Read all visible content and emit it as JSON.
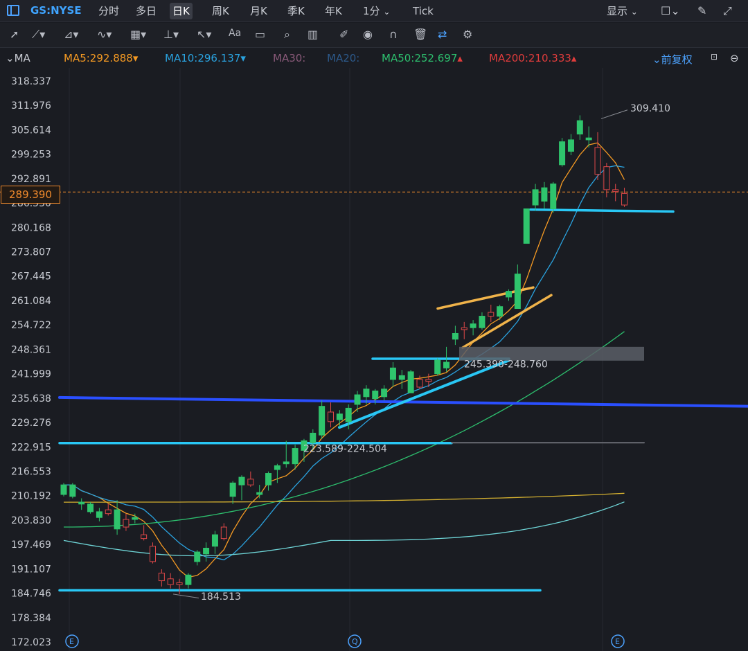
{
  "header": {
    "symbol": "GS:NYSE",
    "tabs": [
      "分时",
      "多日",
      "日K",
      "周K",
      "月K",
      "季K",
      "年K",
      "1分",
      "Tick"
    ],
    "active_tab": "日K",
    "display_label": "显示"
  },
  "toolbar": {
    "tools": [
      "cursor-icon",
      "line-tool-icon",
      "polyline-tool-icon",
      "wave-tool-icon",
      "fibonacci-tool-icon",
      "level-tool-icon",
      "arrow-tool-icon",
      "text-tool-icon",
      "comment-tool-icon",
      "search-icon",
      "indicator-icon",
      "pen-icon",
      "eye-icon",
      "magnet-icon",
      "trash-icon",
      "sync-icon",
      "gear-icon"
    ],
    "text_tool_label": "Aa"
  },
  "ma_bar": {
    "label": "MA",
    "ma5": "MA5:292.888",
    "ma10": "MA10:296.137",
    "ma30": "MA30:",
    "ma20": "MA20:",
    "ma50": "MA50:252.697",
    "ma200": "MA200:210.333",
    "adjust": "前复权",
    "colors": {
      "ma5": "#f59a23",
      "ma10": "#2aa3e0",
      "ma30": "#8a5a7a",
      "ma20": "#2d5a8c",
      "ma50": "#2dbf6e",
      "ma200": "#e03c3c"
    }
  },
  "current_price": "289.390",
  "chart_data": {
    "type": "candlestick",
    "y_ticks": [
      "318.337",
      "311.976",
      "305.614",
      "299.253",
      "292.891",
      "286.530",
      "280.168",
      "273.807",
      "267.445",
      "261.084",
      "254.722",
      "248.361",
      "241.999",
      "235.638",
      "229.276",
      "222.915",
      "216.553",
      "210.192",
      "203.830",
      "197.469",
      "191.107",
      "184.746",
      "178.384",
      "172.023"
    ],
    "ylim": [
      172.023,
      318.337
    ],
    "annotations": {
      "high": "309.410",
      "low": "184.513",
      "zone_upper": "245.390-248.760",
      "zone_lower": "223.589-224.504"
    },
    "event_markers": [
      "E",
      "Q",
      "E"
    ],
    "candles": [
      {
        "o": 210.5,
        "h": 213.5,
        "l": 210.0,
        "c": 213.0
      },
      {
        "o": 210.0,
        "h": 213.5,
        "l": 209.5,
        "c": 213.0
      },
      {
        "o": 208.0,
        "h": 209.5,
        "l": 206.5,
        "c": 208.5
      },
      {
        "o": 206.0,
        "h": 208.5,
        "l": 205.5,
        "c": 208.0
      },
      {
        "o": 204.5,
        "h": 207.0,
        "l": 203.5,
        "c": 206.0
      },
      {
        "o": 206.5,
        "h": 208.0,
        "l": 205.0,
        "c": 205.5
      },
      {
        "o": 201.5,
        "h": 209.0,
        "l": 200.0,
        "c": 206.5
      },
      {
        "o": 204.0,
        "h": 205.5,
        "l": 201.0,
        "c": 202.0
      },
      {
        "o": 204.0,
        "h": 205.5,
        "l": 203.0,
        "c": 204.5
      },
      {
        "o": 200.0,
        "h": 202.5,
        "l": 198.5,
        "c": 199.0
      },
      {
        "o": 197.0,
        "h": 198.0,
        "l": 192.5,
        "c": 193.0
      },
      {
        "o": 190.0,
        "h": 191.0,
        "l": 186.5,
        "c": 188.0
      },
      {
        "o": 188.5,
        "h": 190.0,
        "l": 186.0,
        "c": 187.0
      },
      {
        "o": 187.5,
        "h": 188.5,
        "l": 184.5,
        "c": 187.0
      },
      {
        "o": 187.0,
        "h": 190.0,
        "l": 186.0,
        "c": 189.5
      },
      {
        "o": 193.0,
        "h": 196.0,
        "l": 192.0,
        "c": 195.5
      },
      {
        "o": 195.0,
        "h": 198.0,
        "l": 193.0,
        "c": 196.5
      },
      {
        "o": 197.0,
        "h": 201.0,
        "l": 195.0,
        "c": 200.0
      },
      {
        "o": 202.0,
        "h": 203.0,
        "l": 198.5,
        "c": 199.0
      },
      {
        "o": 210.0,
        "h": 214.0,
        "l": 208.0,
        "c": 213.5
      },
      {
        "o": 213.0,
        "h": 215.5,
        "l": 209.0,
        "c": 215.0
      },
      {
        "o": 214.5,
        "h": 216.5,
        "l": 212.5,
        "c": 213.0
      },
      {
        "o": 210.5,
        "h": 213.0,
        "l": 209.5,
        "c": 211.0
      },
      {
        "o": 213.0,
        "h": 216.5,
        "l": 211.5,
        "c": 216.0
      },
      {
        "o": 217.0,
        "h": 218.5,
        "l": 213.5,
        "c": 218.0
      },
      {
        "o": 218.5,
        "h": 224.5,
        "l": 217.5,
        "c": 219.0
      },
      {
        "o": 218.5,
        "h": 223.5,
        "l": 217.0,
        "c": 222.5
      },
      {
        "o": 222.0,
        "h": 225.0,
        "l": 219.0,
        "c": 224.5
      },
      {
        "o": 224.0,
        "h": 227.5,
        "l": 222.0,
        "c": 226.5
      },
      {
        "o": 226.0,
        "h": 235.0,
        "l": 225.0,
        "c": 233.5
      },
      {
        "o": 232.0,
        "h": 234.5,
        "l": 228.0,
        "c": 229.5
      },
      {
        "o": 230.0,
        "h": 232.5,
        "l": 228.0,
        "c": 231.5
      },
      {
        "o": 229.5,
        "h": 234.0,
        "l": 227.5,
        "c": 233.0
      },
      {
        "o": 234.0,
        "h": 237.5,
        "l": 232.0,
        "c": 236.5
      },
      {
        "o": 236.0,
        "h": 239.0,
        "l": 234.0,
        "c": 238.0
      },
      {
        "o": 235.5,
        "h": 238.0,
        "l": 234.0,
        "c": 237.5
      },
      {
        "o": 236.0,
        "h": 239.0,
        "l": 235.0,
        "c": 238.0
      },
      {
        "o": 240.5,
        "h": 245.0,
        "l": 238.5,
        "c": 243.5
      },
      {
        "o": 240.5,
        "h": 243.0,
        "l": 238.0,
        "c": 241.5
      },
      {
        "o": 237.0,
        "h": 243.0,
        "l": 237.0,
        "c": 242.5
      },
      {
        "o": 240.5,
        "h": 241.5,
        "l": 238.0,
        "c": 238.5
      },
      {
        "o": 240.5,
        "h": 242.0,
        "l": 238.5,
        "c": 240.0
      },
      {
        "o": 242.0,
        "h": 246.0,
        "l": 241.5,
        "c": 245.5
      },
      {
        "o": 243.5,
        "h": 249.0,
        "l": 242.5,
        "c": 245.0
      },
      {
        "o": 251.0,
        "h": 254.5,
        "l": 249.5,
        "c": 252.5
      },
      {
        "o": 254.0,
        "h": 255.5,
        "l": 251.0,
        "c": 253.5
      },
      {
        "o": 254.0,
        "h": 256.0,
        "l": 252.0,
        "c": 255.0
      },
      {
        "o": 254.0,
        "h": 258.0,
        "l": 253.5,
        "c": 257.0
      },
      {
        "o": 258.0,
        "h": 260.0,
        "l": 255.5,
        "c": 257.0
      },
      {
        "o": 257.0,
        "h": 260.0,
        "l": 256.0,
        "c": 259.5
      },
      {
        "o": 262.0,
        "h": 264.0,
        "l": 261.0,
        "c": 263.5
      },
      {
        "o": 259.0,
        "h": 270.5,
        "l": 259.0,
        "c": 268.0
      },
      {
        "o": 276.0,
        "h": 277.5,
        "l": 278.0,
        "c": 285.0
      },
      {
        "o": 286.0,
        "h": 291.5,
        "l": 284.5,
        "c": 290.0
      },
      {
        "o": 287.0,
        "h": 292.0,
        "l": 285.0,
        "c": 290.5
      },
      {
        "o": 285.0,
        "h": 292.0,
        "l": 284.0,
        "c": 291.5
      },
      {
        "o": 296.5,
        "h": 303.5,
        "l": 296.0,
        "c": 302.5
      },
      {
        "o": 300.0,
        "h": 304.5,
        "l": 299.0,
        "c": 303.0
      },
      {
        "o": 304.5,
        "h": 309.4,
        "l": 303.0,
        "c": 308.0
      },
      {
        "o": 303.0,
        "h": 306.5,
        "l": 301.0,
        "c": 303.5
      },
      {
        "o": 301.0,
        "h": 305.0,
        "l": 292.5,
        "c": 294.0
      },
      {
        "o": 296.0,
        "h": 297.0,
        "l": 288.0,
        "c": 290.0
      },
      {
        "o": 290.0,
        "h": 291.5,
        "l": 287.0,
        "c": 289.5
      },
      {
        "o": 289.0,
        "h": 290.5,
        "l": 285.5,
        "c": 286.0
      }
    ]
  }
}
